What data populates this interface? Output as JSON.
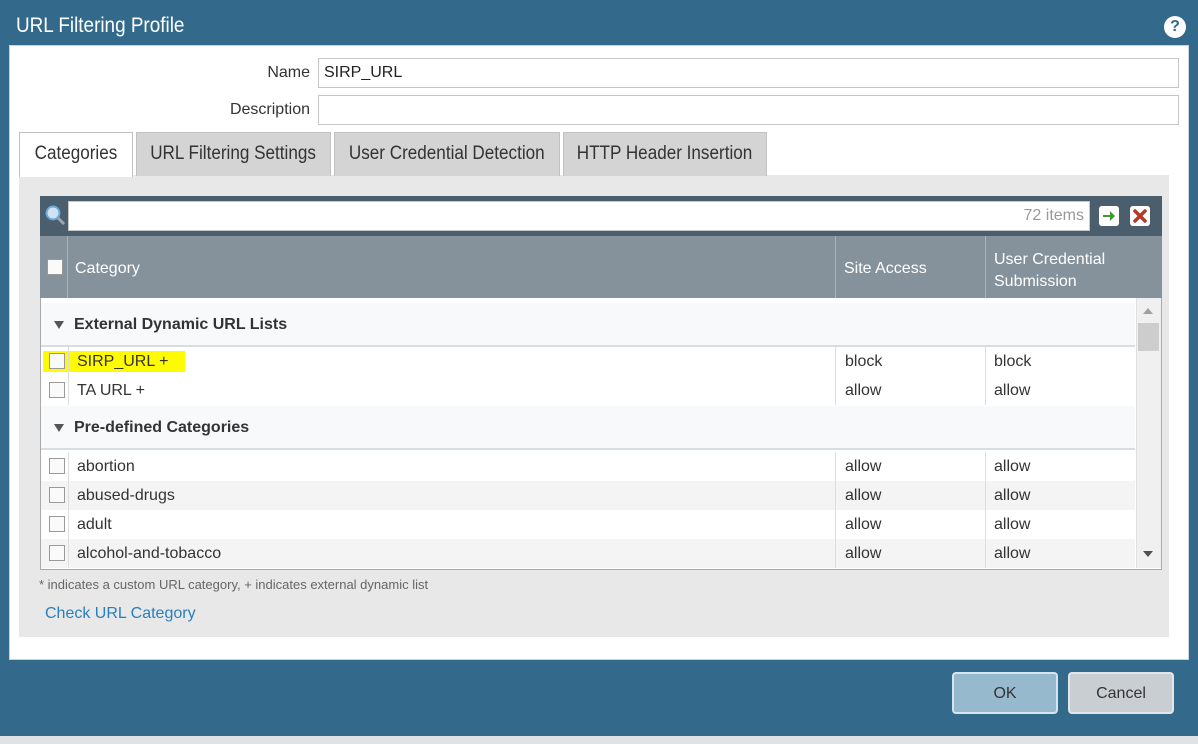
{
  "window": {
    "title": "URL Filtering Profile"
  },
  "form": {
    "name_label": "Name",
    "name_value": "SIRP_URL",
    "description_label": "Description",
    "description_value": ""
  },
  "tabs": [
    {
      "label": "Categories",
      "active": true
    },
    {
      "label": "URL Filtering Settings",
      "active": false
    },
    {
      "label": "User Credential Detection",
      "active": false
    },
    {
      "label": "HTTP Header Insertion",
      "active": false
    }
  ],
  "search": {
    "value": "",
    "count_text": "72 items"
  },
  "columns": {
    "category": "Category",
    "site_access": "Site Access",
    "cred_line1": "User Credential",
    "cred_line2": "Submission"
  },
  "groups": [
    {
      "name": "External Dynamic URL Lists",
      "rows": [
        {
          "name": "SIRP_URL +",
          "site": "block",
          "cred": "block",
          "highlighted": true
        },
        {
          "name": "TA URL +",
          "site": "allow",
          "cred": "allow"
        }
      ]
    },
    {
      "name": "Pre-defined Categories",
      "rows": [
        {
          "name": "abortion",
          "site": "allow",
          "cred": "allow"
        },
        {
          "name": "abused-drugs",
          "site": "allow",
          "cred": "allow"
        },
        {
          "name": "adult",
          "site": "allow",
          "cred": "allow"
        },
        {
          "name": "alcohol-and-tobacco",
          "site": "allow",
          "cred": "allow"
        }
      ]
    }
  ],
  "footnote": "* indicates a custom URL category, + indicates external dynamic list",
  "check_link": "Check URL Category",
  "buttons": {
    "ok": "OK",
    "cancel": "Cancel"
  },
  "colors": {
    "title_bar": "#336a8c",
    "header_row": "#85929c",
    "toolbar": "#4a5e6e",
    "link": "#2a7fbb",
    "highlight": "#fffb00"
  }
}
